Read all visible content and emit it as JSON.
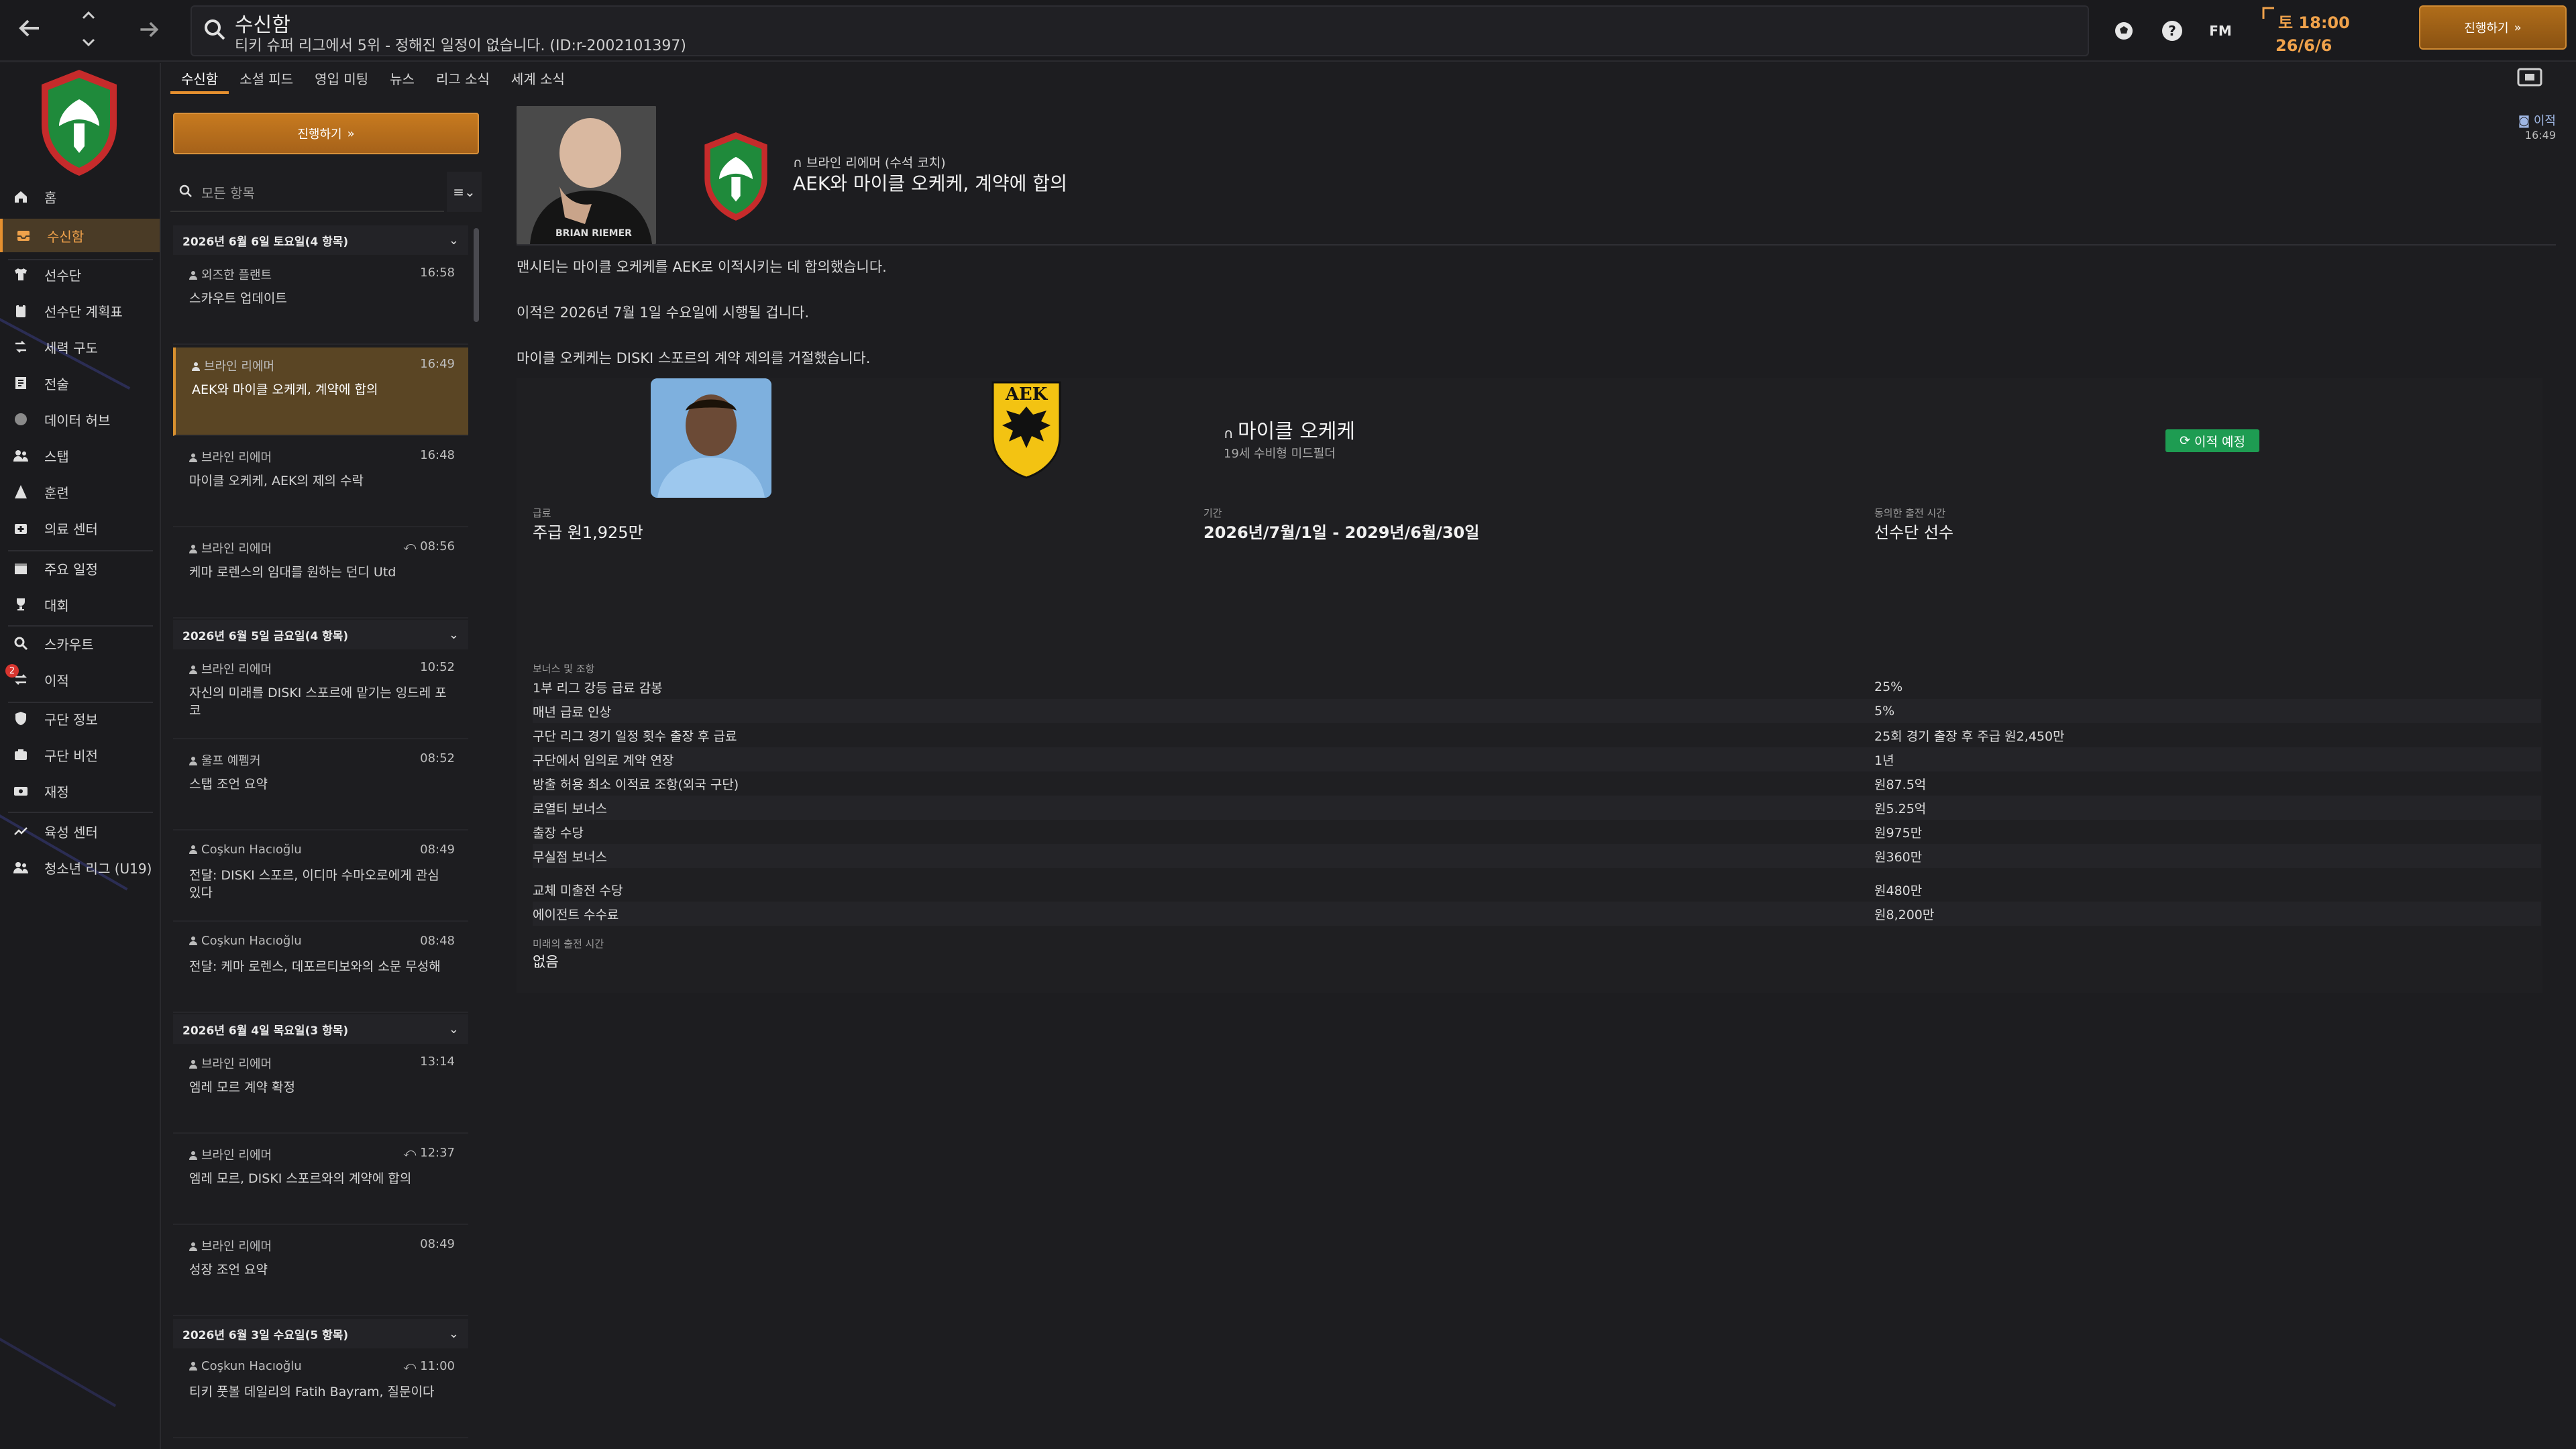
{
  "topbar": {
    "title": "수신함",
    "subtitle": "티키 슈퍼 리그에서 5위 - 정해진 일정이 없습니다. (ID:r-2002101397)",
    "fm_label": "FM",
    "date_line1": "토 18:00",
    "date_line2": "26/6/6",
    "continue_label": "진행하기"
  },
  "sidebar": {
    "items": [
      {
        "label": "홈",
        "icon": "home-icon"
      },
      {
        "label": "수신함",
        "icon": "inbox-icon",
        "active": true
      },
      {
        "label": "선수단",
        "icon": "shirt-icon"
      },
      {
        "label": "선수단 계획표",
        "icon": "clipboard-icon"
      },
      {
        "label": "세력 구도",
        "icon": "dynamics-icon"
      },
      {
        "label": "전술",
        "icon": "tactics-icon"
      },
      {
        "label": "데이터 허브",
        "icon": "data-hub-icon"
      },
      {
        "label": "스탭",
        "icon": "staff-icon"
      },
      {
        "label": "훈련",
        "icon": "training-icon"
      },
      {
        "label": "의료 센터",
        "icon": "medical-icon"
      },
      {
        "label": "주요 일정",
        "icon": "calendar-icon"
      },
      {
        "label": "대회",
        "icon": "trophy-icon"
      },
      {
        "label": "스카우트",
        "icon": "scout-icon"
      },
      {
        "label": "이적",
        "icon": "transfer-icon",
        "badge": "2"
      },
      {
        "label": "구단 정보",
        "icon": "club-info-icon"
      },
      {
        "label": "구단 비전",
        "icon": "vision-icon"
      },
      {
        "label": "재정",
        "icon": "finance-icon"
      },
      {
        "label": "육성 센터",
        "icon": "development-icon"
      },
      {
        "label": "청소년 리그 (U19)",
        "icon": "youth-icon"
      }
    ]
  },
  "subtabs": [
    "수신함",
    "소셜 피드",
    "영입 미팅",
    "뉴스",
    "리그 소식",
    "세계 소식"
  ],
  "inbox": {
    "continue_label": "진행하기",
    "search_placeholder": "모든 항목",
    "groups": [
      {
        "label": "2026년 6월 6일 토요일(4 항목)"
      },
      {
        "label": "2026년 6월 5일 금요일(4 항목)"
      },
      {
        "label": "2026년 6월 4일 목요일(3 항목)"
      },
      {
        "label": "2026년 6월 3일 수요일(5 항목)"
      }
    ],
    "messages": [
      {
        "sender": "외즈한 플랜트",
        "time": "16:58",
        "subject": "스카우트 업데이트"
      },
      {
        "sender": "브라인 리에머",
        "time": "16:49",
        "subject": "AEK와 마이클 오케케, 계약에 합의"
      },
      {
        "sender": "브라인 리에머",
        "time": "16:48",
        "subject": "마이클 오케케, AEK의 제의 수락"
      },
      {
        "sender": "브라인 리에머",
        "time": "08:56",
        "subject": "케마 로렌스의 임대를 원하는 던디 Utd"
      },
      {
        "sender": "브라인 리에머",
        "time": "10:52",
        "subject": "자신의 미래를 DISKI 스포르에 맡기는 잉드레 포코"
      },
      {
        "sender": "울프 예펨커",
        "time": "08:52",
        "subject": "스탭 조언 요약"
      },
      {
        "sender": "Coşkun Hacıoğlu",
        "time": "08:49",
        "subject": "전달: DISKI 스포르, 이디마 수마오로에게 관심 있다"
      },
      {
        "sender": "Coşkun Hacıoğlu",
        "time": "08:48",
        "subject": "전달: 케마 로렌스, 데포르티보와의 소문 무성해"
      },
      {
        "sender": "브라인 리에머",
        "time": "13:14",
        "subject": "엠레 모르 계약 확정"
      },
      {
        "sender": "브라인 리에머",
        "time": "12:37",
        "subject": "엠레 모르, DISKI 스포르와의 계약에 합의"
      },
      {
        "sender": "브라인 리에머",
        "time": "08:49",
        "subject": "성장 조언 요약"
      },
      {
        "sender": "Coşkun Hacıoğlu",
        "time": "11:00",
        "subject": "티키 풋볼 데일리의 Fatih Bayram, 질문이다"
      }
    ]
  },
  "detail": {
    "photo_label": "BRIAN RIEMER",
    "sender": "브라인 리에머 (수석 코치)",
    "subject": "AEK와 마이클 오케케, 계약에 합의",
    "tag": "이적",
    "time": "16:49",
    "paragraphs": [
      "맨시티는 마이클 오케케를 AEK로 이적시키는 데 합의했습니다.",
      "이적은 2026년 7월 1일 수요일에 시행될 겁니다.",
      "마이클 오케케는 DISKI 스포르의 계약 제의를 거절했습니다."
    ],
    "player": {
      "name": "마이클 오케케",
      "info": "19세 수비형 미드필더",
      "status": "이적 예정",
      "aek_text": "ΑΕΚ"
    },
    "wage_label": "급료",
    "wage_value": "주급 원1,925만",
    "period_label": "기간",
    "period_value": "2026년/7월/1일 - 2029년/6월/30일",
    "playing_label": "동의한 출전 시간",
    "playing_value": "선수단 선수",
    "bonus_title": "보너스 및 조항",
    "bonuses": [
      {
        "label": "1부 리그 강등 급료 감봉",
        "value": "25%"
      },
      {
        "label": "매년 급료 인상",
        "value": "5%"
      },
      {
        "label": "구단 리그 경기 일정 횟수 출장 후 급료",
        "value": "25회 경기 출장 후 주급 원2,450만"
      },
      {
        "label": "구단에서 임의로 계약 연장",
        "value": "1년"
      },
      {
        "label": "방출 허용 최소 이적료 조항(외국 구단)",
        "value": "원87.5억"
      },
      {
        "label": "로열티 보너스",
        "value": "원5.25억"
      },
      {
        "label": "출장 수당",
        "value": "원975만"
      },
      {
        "label": "무실점 보너스",
        "value": "원360만"
      },
      {
        "label": "교체 미출전 수당",
        "value": "원480만"
      },
      {
        "label": "에이전트 수수료",
        "value": "원8,200만"
      }
    ],
    "future_label": "미래의 출전 시간",
    "future_value": "없음"
  },
  "colors": {
    "accent": "#e6902f",
    "selected_row": "#5a4524",
    "badge_green": "#1e9c52"
  }
}
